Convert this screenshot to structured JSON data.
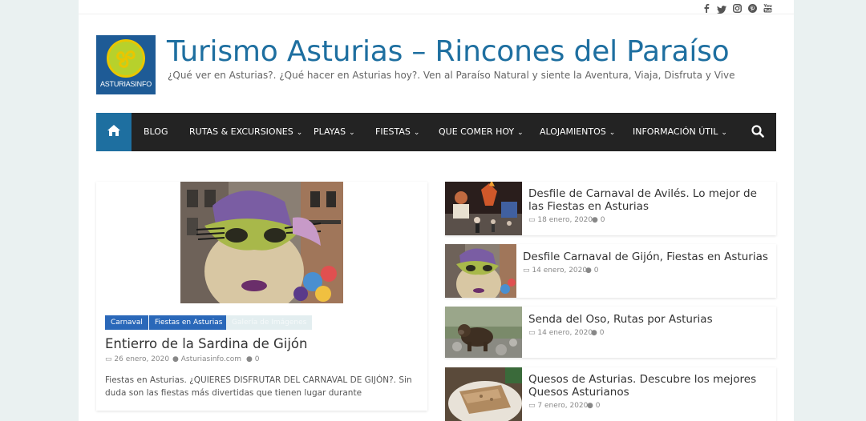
{
  "social": {
    "icons": [
      "facebook-icon",
      "twitter-icon",
      "instagram-icon",
      "pinterest-icon",
      "youtube-icon"
    ]
  },
  "header": {
    "logo_text": "ASTURIASINFO",
    "site_title": "Turismo Asturias – Rincones del Paraíso",
    "tagline": "¿Qué ver en Asturias?. ¿Qué hacer en Asturias hoy?. Ven al Paraíso Natural y siente la Aventura, Viaja, Disfruta y Vive"
  },
  "nav": {
    "items": [
      {
        "label": "BLOG",
        "dropdown": false
      },
      {
        "label": "RUTAS & EXCURSIONES",
        "dropdown": true
      },
      {
        "label": "PLAYAS",
        "dropdown": true
      },
      {
        "label": "FIESTAS",
        "dropdown": true
      },
      {
        "label": "QUE COMER HOY",
        "dropdown": true
      },
      {
        "label": "ALOJAMIENTOS",
        "dropdown": true
      },
      {
        "label": "INFORMACIÓN ÚTIL",
        "dropdown": true
      }
    ],
    "chevron": "⌄"
  },
  "feature": {
    "tags": [
      "Carnaval",
      "Fiestas en Asturias",
      "Galería de Imágenes"
    ],
    "title": "Entierro de la Sardina de Gijón",
    "date": "26 enero, 2020",
    "author": "Asturiasinfo.com",
    "comments": "0",
    "excerpt": "Fiestas en Asturias. ¿QUIERES DISFRUTAR DEL CARNAVAL DE GIJÓN?. Sin duda son las fiestas más divertidas que tienen lugar durante"
  },
  "side_posts": [
    {
      "title": "Desfile de Carnaval de Avilés. Lo mejor de las Fiestas en Asturias",
      "date": "18 enero, 2020",
      "comments": "0"
    },
    {
      "title": "Desfile Carnaval de Gijón, Fiestas en Asturias",
      "date": "14 enero, 2020",
      "comments": "0"
    },
    {
      "title": "Senda del Oso, Rutas por Asturias",
      "date": "14 enero, 2020",
      "comments": "0"
    },
    {
      "title": "Quesos de Asturias. Descubre los mejores Quesos Asturianos",
      "date": "7 enero, 2020",
      "comments": "0"
    }
  ],
  "colors": {
    "brand_blue": "#1e6fa0",
    "nav_bg": "#232323",
    "tag_blue": "#2a68b9",
    "background": "#eaf1f1"
  }
}
